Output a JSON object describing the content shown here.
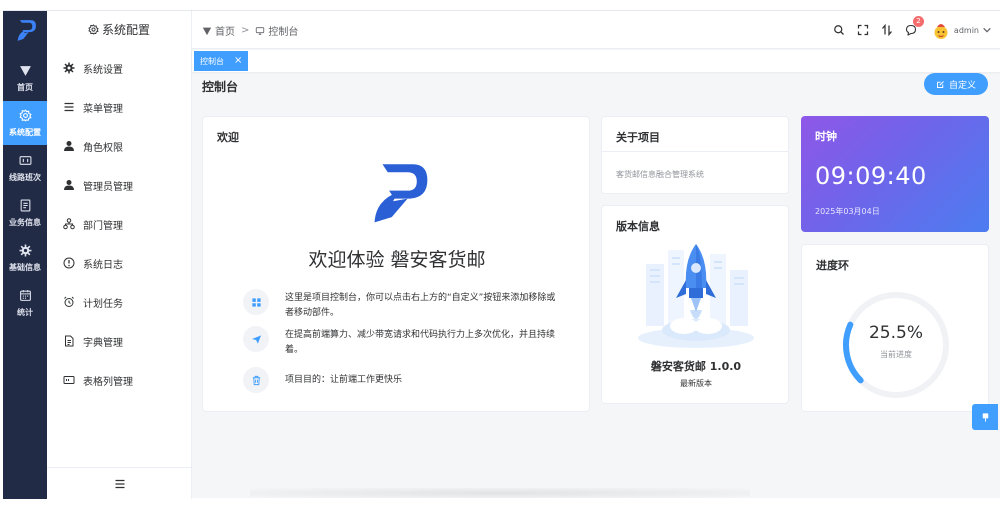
{
  "rail": {
    "items": [
      {
        "label": "首页",
        "icon": "triangle-down-icon"
      },
      {
        "label": "系统配置",
        "icon": "gear-icon"
      },
      {
        "label": "线路班次",
        "icon": "schedule-icon"
      },
      {
        "label": "业务信息",
        "icon": "document-icon"
      },
      {
        "label": "基础信息",
        "icon": "gear-icon"
      },
      {
        "label": "统计",
        "icon": "calendar-icon"
      }
    ],
    "active_index": 1
  },
  "submenu": {
    "title": "系统配置",
    "items": [
      {
        "label": "系统设置",
        "icon": "gear-icon"
      },
      {
        "label": "菜单管理",
        "icon": "list-icon"
      },
      {
        "label": "角色权限",
        "icon": "user-icon"
      },
      {
        "label": "管理员管理",
        "icon": "user-icon"
      },
      {
        "label": "部门管理",
        "icon": "org-icon"
      },
      {
        "label": "系统日志",
        "icon": "info-icon"
      },
      {
        "label": "计划任务",
        "icon": "alarm-clock-icon"
      },
      {
        "label": "字典管理",
        "icon": "file-icon"
      },
      {
        "label": "表格列管理",
        "icon": "table-icon"
      }
    ]
  },
  "header": {
    "breadcrumb": [
      {
        "label": "首页"
      },
      {
        "label": "控制台"
      }
    ],
    "notification_count": "2",
    "user_name": "admin"
  },
  "tabs": [
    {
      "label": "控制台",
      "active": true
    }
  ],
  "page": {
    "title": "控制台",
    "custom_button": "自定义"
  },
  "welcome": {
    "title": "欢迎",
    "heading": "欢迎体验 磐安客货邮",
    "features": [
      {
        "icon": "grid-icon",
        "text": "这里是项目控制台，你可以点击右上方的“自定义”按钮来添加移除或者移动部件。"
      },
      {
        "icon": "paper-plane-icon",
        "text": "在提高前端算力、减少带宽请求和代码执行力上多次优化，并且持续着。"
      },
      {
        "icon": "trash-icon",
        "text": "项目目的：让前端工作更快乐"
      }
    ]
  },
  "about": {
    "title": "关于项目",
    "text": "客货邮信息融合管理系统"
  },
  "version": {
    "title": "版本信息",
    "name": "磐安客货邮 1.0.0",
    "subtitle": "最新版本"
  },
  "clock": {
    "title": "时钟",
    "time": "09:09:40",
    "date": "2025年03月04日"
  },
  "progress": {
    "title": "进度环",
    "value": 25.5,
    "value_label": "25.5%",
    "label": "当前进度"
  },
  "colors": {
    "rail_bg": "#222b45",
    "accent": "#409eff",
    "clock_gradient_start": "#8f57e8",
    "clock_gradient_end": "#4c7df0",
    "logo_blue": "#2a5fd6"
  }
}
